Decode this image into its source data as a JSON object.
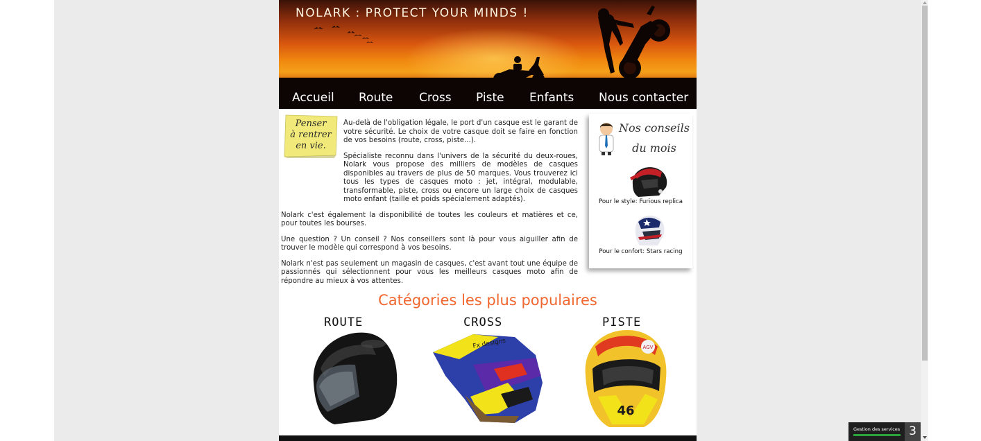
{
  "header": {
    "site_title": "NOLARK : PROTECT YOUR MINDS !"
  },
  "nav": {
    "items": [
      {
        "label": "Accueil"
      },
      {
        "label": "Route"
      },
      {
        "label": "Cross"
      },
      {
        "label": "Piste"
      },
      {
        "label": "Enfants"
      },
      {
        "label": "Nous contacter"
      }
    ]
  },
  "postit": {
    "text_lines": [
      "Penser",
      "à rentrer",
      "en vie."
    ]
  },
  "intro": {
    "paragraphs": [
      "Au-delà de l'obligation légale, le port d'un casque est le garant de votre sécurité. Le choix de votre casque doit se faire en fonction de vos besoins (route, cross, piste...).",
      "Spécialiste reconnu dans l'univers de la sécurité du deux-roues, Nolark vous propose des milliers de modèles de casques disponibles au travers de plus de 50 marques. Vous trouverez ici tous les types de casques moto : jet, intégral, modulable, transformable, piste, cross ou encore un large choix de casques moto enfant (taille et poids spécialement adaptés).",
      "Nolark c'est également la disponibilité de toutes les couleurs et matières et ce, pour toutes les bourses.",
      "Une question ? Un conseil ? Nos conseillers sont là pour vous aiguiller afin de trouver le modèle qui correspond à vos besoins.",
      "Nolark n'est pas seulement un magasin de casques, c'est avant tout une équipe de passionnés qui sélectionnent pour vous les meilleurs casques moto afin de répondre au mieux à vos attentes."
    ]
  },
  "advice": {
    "title_line1": "Nos conseils",
    "title_line2": "du mois",
    "items": [
      {
        "caption": "Pour le style: Furious replica"
      },
      {
        "caption": "Pour le confort: Stars racing"
      }
    ]
  },
  "categories": {
    "title": "Catégories les plus populaires",
    "items": [
      {
        "name": "ROUTE"
      },
      {
        "name": "CROSS"
      },
      {
        "name": "PISTE"
      }
    ]
  },
  "cookie_widget": {
    "label": "Gestion des services",
    "count": "3"
  },
  "colors": {
    "accent": "#f0662e",
    "page_background": "#ebebeb",
    "nav_text": "#ffffff"
  }
}
